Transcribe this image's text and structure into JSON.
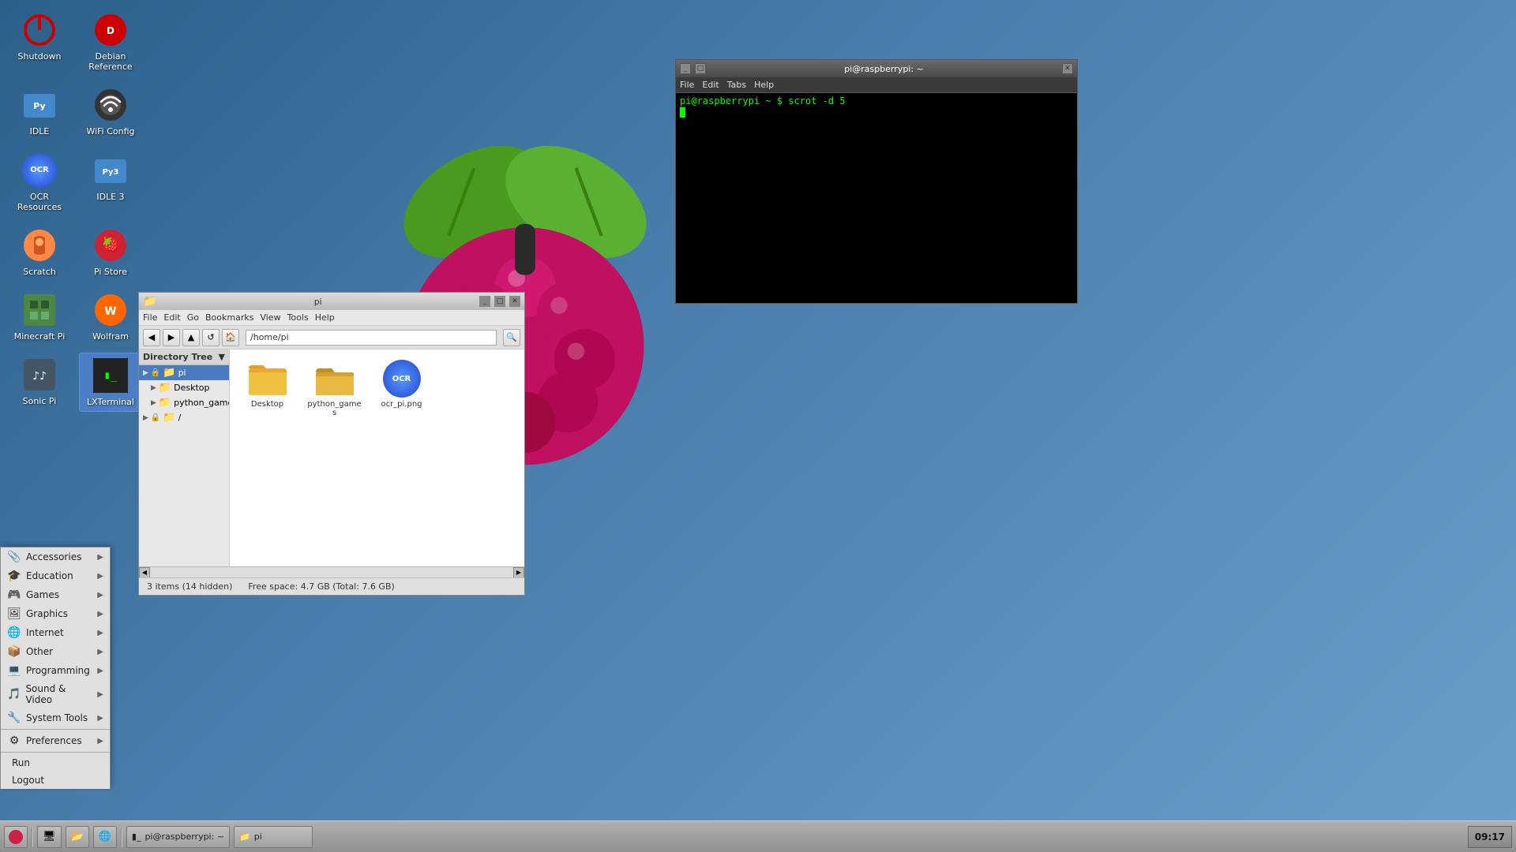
{
  "desktop": {
    "icons": [
      {
        "id": "shutdown",
        "label": "Shutdown",
        "icon": "⏻",
        "type": "power"
      },
      {
        "id": "debian-ref",
        "label": "Debian\nReference",
        "icon": "🔴",
        "type": "debian"
      },
      {
        "id": "idle",
        "label": "IDLE",
        "icon": "🐍",
        "type": "python"
      },
      {
        "id": "wifi-config",
        "label": "WiFi Config",
        "icon": "📡",
        "type": "wifi"
      },
      {
        "id": "ocr-resources",
        "label": "OCR\nResources",
        "icon": "OCR",
        "type": "ocr"
      },
      {
        "id": "idle3",
        "label": "IDLE 3",
        "icon": "🐍",
        "type": "python"
      },
      {
        "id": "scratch",
        "label": "Scratch",
        "icon": "🐱",
        "type": "scratch"
      },
      {
        "id": "pi-store",
        "label": "Pi Store",
        "icon": "🍓",
        "type": "pistore"
      },
      {
        "id": "minecraft",
        "label": "Minecraft Pi",
        "icon": "⛏",
        "type": "minecraft"
      },
      {
        "id": "wolfram",
        "label": "Wolfram",
        "icon": "Wf",
        "type": "wolfram"
      },
      {
        "id": "sonic-pi",
        "label": "Sonic Pi",
        "icon": "♪♪",
        "type": "sonic"
      },
      {
        "id": "lxterminal",
        "label": "LXTerminal",
        "icon": ">_",
        "type": "terminal",
        "selected": true
      }
    ]
  },
  "terminal": {
    "title": "pi@raspberrypi: ~",
    "menu": [
      "File",
      "Edit",
      "Tabs",
      "Help"
    ],
    "prompt": "pi@raspberrypi",
    "command": "scrot -d 5",
    "prompt_char": "~"
  },
  "filemanager": {
    "title": "pi",
    "menu": [
      "File",
      "Edit",
      "Go",
      "Bookmarks",
      "View",
      "Tools",
      "Help"
    ],
    "address": "/home/pi",
    "sidebar_header": "Directory Tree",
    "tree": [
      {
        "name": "pi",
        "indent": 0,
        "selected": true,
        "locked": true
      },
      {
        "name": "Desktop",
        "indent": 1,
        "selected": false
      },
      {
        "name": "python_games",
        "indent": 1,
        "selected": false
      },
      {
        "name": "/",
        "indent": 0,
        "selected": false,
        "locked": true
      }
    ],
    "files": [
      {
        "name": "Desktop",
        "icon": "folder"
      },
      {
        "name": "python_games",
        "icon": "folder"
      },
      {
        "name": "ocr_pi.png",
        "icon": "ocr"
      }
    ],
    "status_left": "3 items (14 hidden)",
    "status_right": "Free space: 4.7 GB (Total: 7.6 GB)"
  },
  "start_menu": {
    "items": [
      {
        "label": "Accessories",
        "icon": "📎",
        "has_arrow": true
      },
      {
        "label": "Education",
        "icon": "🎓",
        "has_arrow": true
      },
      {
        "label": "Games",
        "icon": "🎮",
        "has_arrow": true
      },
      {
        "label": "Graphics",
        "icon": "🖼",
        "has_arrow": true
      },
      {
        "label": "Internet",
        "icon": "🌐",
        "has_arrow": true
      },
      {
        "label": "Other",
        "icon": "📦",
        "has_arrow": true
      },
      {
        "label": "Programming",
        "icon": "💻",
        "has_arrow": true
      },
      {
        "label": "Sound & Video",
        "icon": "🎵",
        "has_arrow": true
      },
      {
        "label": "System Tools",
        "icon": "🔧",
        "has_arrow": true
      },
      {
        "separator": true
      },
      {
        "label": "Preferences",
        "icon": "⚙",
        "has_arrow": true
      },
      {
        "separator": true
      },
      {
        "label": "Run",
        "icon": "",
        "has_arrow": false
      },
      {
        "label": "Logout",
        "icon": "",
        "has_arrow": false
      }
    ]
  },
  "taskbar": {
    "time": "09:17",
    "windows": [
      {
        "label": "pi@raspberrypi: ~",
        "icon": ">_"
      },
      {
        "label": "pi",
        "icon": "📁"
      }
    ]
  }
}
